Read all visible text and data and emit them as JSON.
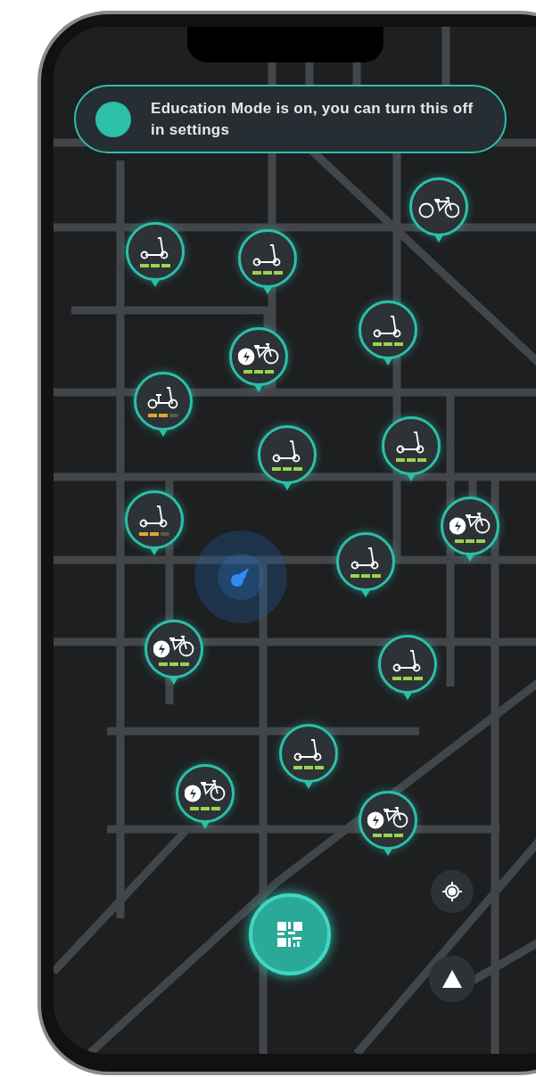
{
  "banner": {
    "text": "Education Mode is on, you can turn this off in settings"
  },
  "vehicles": [
    {
      "kind": "scooter",
      "level": 1,
      "color": "#9ad34f"
    },
    {
      "kind": "scooter",
      "level": 1,
      "color": "#9ad34f"
    },
    {
      "kind": "bike"
    },
    {
      "kind": "scooter",
      "level": 1,
      "color": "#9ad34f"
    },
    {
      "kind": "ebike",
      "level": 1,
      "color": "#9ad34f"
    },
    {
      "kind": "seated_scooter",
      "level": 0.67,
      "color": "#e0a92c"
    },
    {
      "kind": "scooter",
      "level": 1,
      "color": "#9ad34f"
    },
    {
      "kind": "scooter",
      "level": 1,
      "color": "#9ad34f"
    },
    {
      "kind": "scooter",
      "level": 0.67,
      "color": "#e0a92c"
    },
    {
      "kind": "ebike",
      "level": 1,
      "color": "#9ad34f"
    },
    {
      "kind": "scooter",
      "level": 1,
      "color": "#9ad34f"
    },
    {
      "kind": "ebike",
      "level": 1,
      "color": "#9ad34f"
    },
    {
      "kind": "scooter",
      "level": 1,
      "color": "#9ad34f"
    },
    {
      "kind": "scooter",
      "level": 1,
      "color": "#9ad34f"
    },
    {
      "kind": "ebike",
      "level": 1,
      "color": "#9ad34f"
    },
    {
      "kind": "ebike",
      "level": 1,
      "color": "#9ad34f"
    }
  ]
}
